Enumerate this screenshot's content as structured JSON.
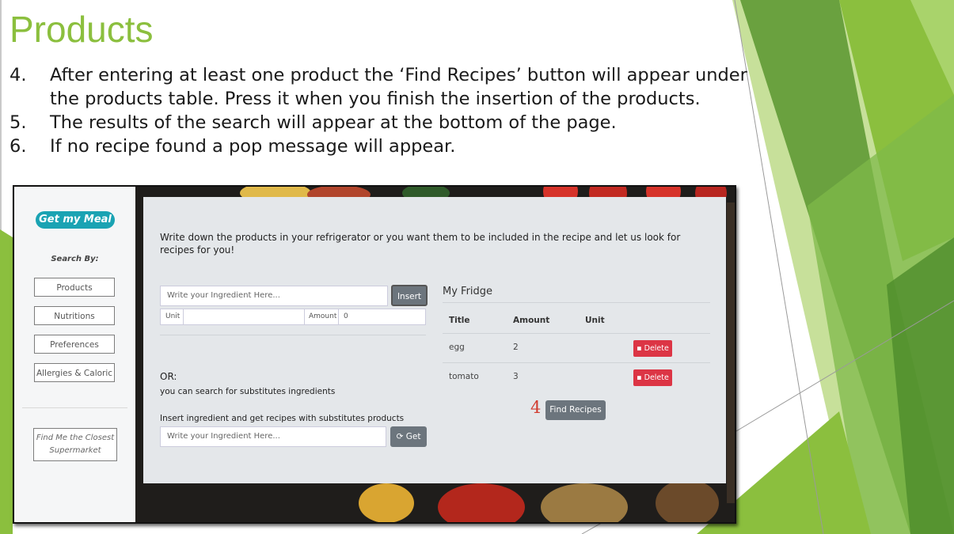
{
  "slide": {
    "title": "Products",
    "bullets": [
      {
        "num": "4.",
        "text": "After entering at least one product the ‘Find Recipes’ button will appear under the products table. Press it when you finish the insertion of the products."
      },
      {
        "num": "5.",
        "text": "The results of the search will appear at the bottom of the page."
      },
      {
        "num": "6.",
        "text": "If no recipe found a pop message will appear."
      }
    ],
    "colors": {
      "accent": "#8bbf3e",
      "decor_light": "#c7e09a",
      "decor_dark": "#5f9a35"
    }
  },
  "app": {
    "logo": "Get my Meal",
    "sidebar": {
      "search_by": "Search By:",
      "items": [
        "Products",
        "Nutritions",
        "Preferences",
        "Allergies & Caloric"
      ],
      "closest": "Find Me the Closest Supermarket"
    },
    "main": {
      "intro": "Write down the products in your refrigerator or you want them to be included in the recipe and let us look for recipes for you!",
      "ingredient_placeholder": "Write your Ingredient Here...",
      "insert_label": "Insert",
      "unit_label": "Unit",
      "amount_label": "Amount",
      "amount_value": "0",
      "or_label": "OR:",
      "substitute_text": "you can search for substitutes ingredients",
      "substitute_instruction": "Insert ingredient and get recipes with substitutes products",
      "substitute_placeholder": "Write your Ingredient Here...",
      "get_label": "Get"
    },
    "fridge": {
      "title": "My Fridge",
      "columns": [
        "Title",
        "Amount",
        "Unit"
      ],
      "rows": [
        {
          "title": "egg",
          "amount": "2",
          "unit": ""
        },
        {
          "title": "tomato",
          "amount": "3",
          "unit": ""
        }
      ],
      "delete_label": "Delete",
      "find_recipes_label": "Find Recipes",
      "step_marker": "4"
    },
    "colors": {
      "logo": "#1aa3b3",
      "delete": "#dc3545",
      "button_gray": "#6c757d"
    }
  }
}
